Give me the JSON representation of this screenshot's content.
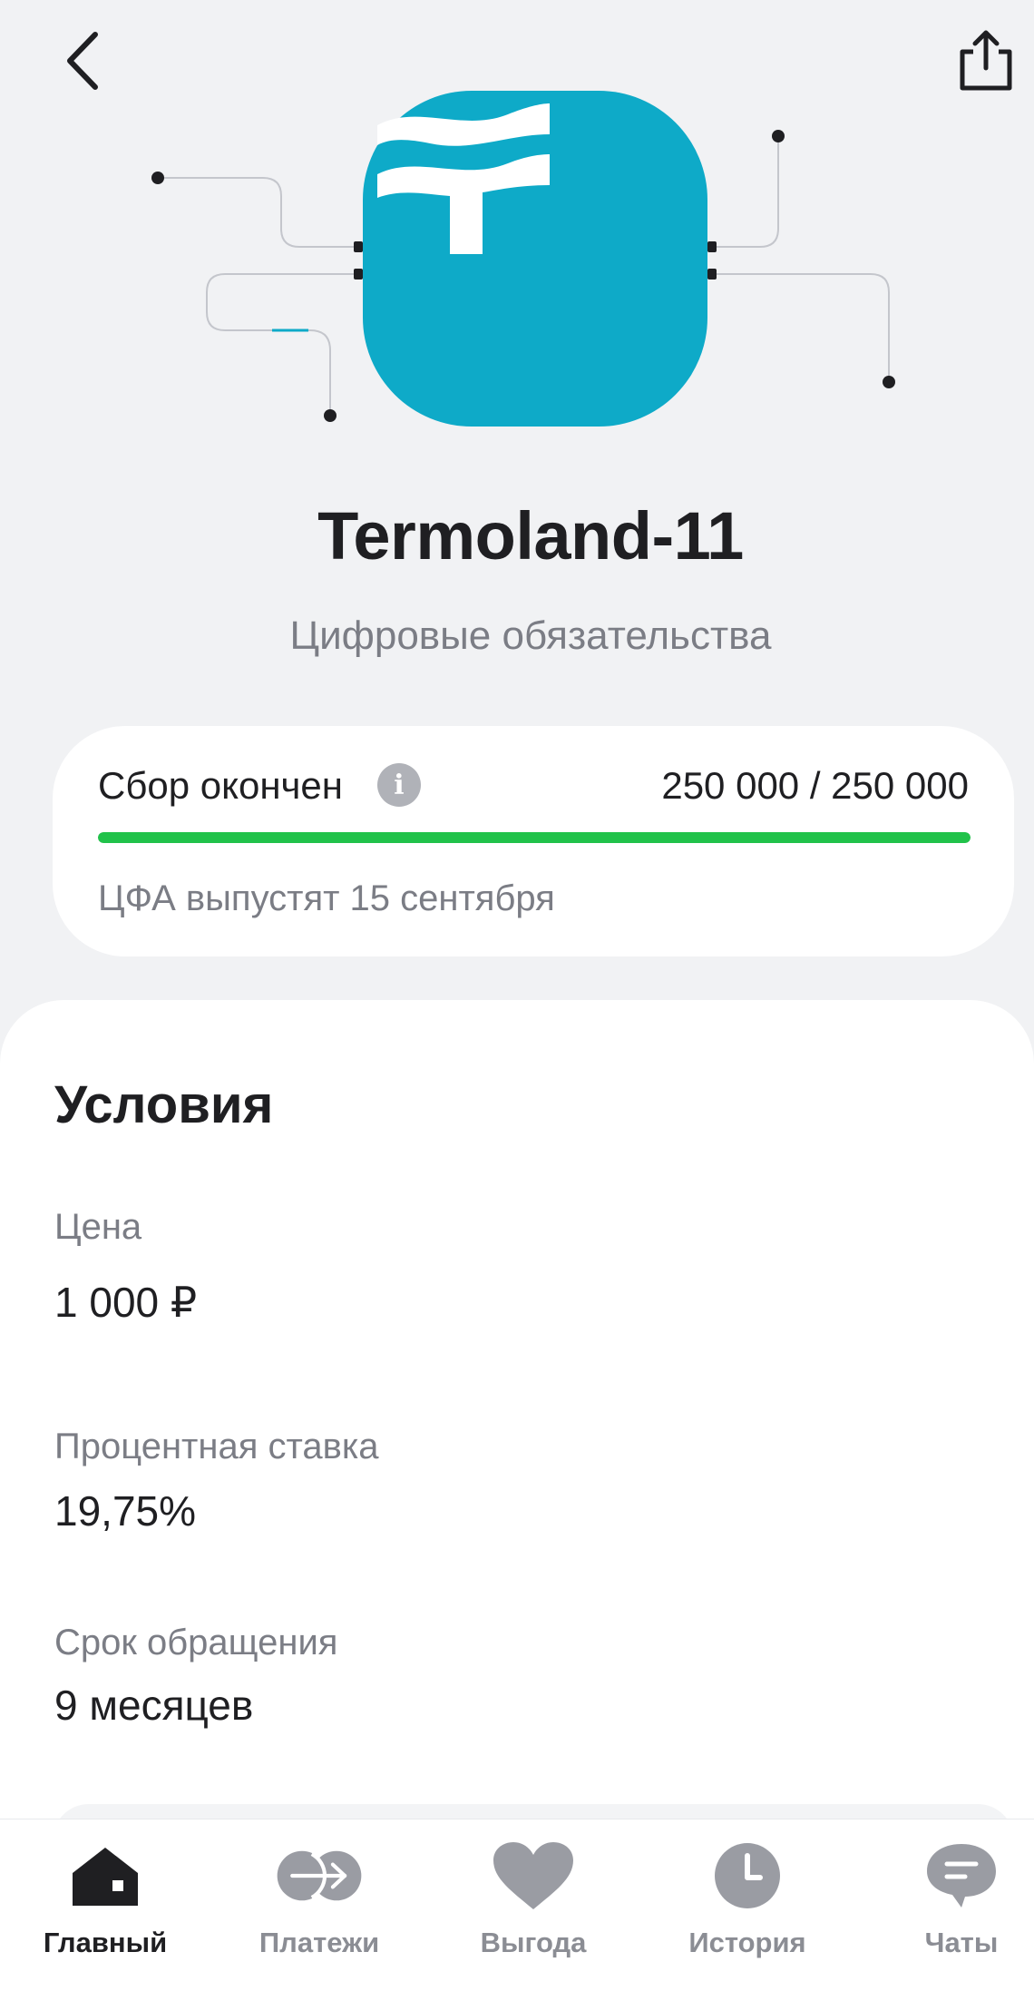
{
  "header": {
    "back_icon": "chevron-left-icon",
    "share_icon": "share-icon"
  },
  "product": {
    "name": "Termoland-11",
    "category": "Цифровые обязательства",
    "logo_icon": "termoland-logo-icon",
    "logo_color": "#0eaac8"
  },
  "fundraising": {
    "status": "Сбор окончен",
    "info_icon": "info-icon",
    "amount": "250 000 / 250 000",
    "progress_fraction": 1.0,
    "progress_color": "#21c24a",
    "note": "ЦФА выпустят 15 сентября"
  },
  "conditions": {
    "title": "Условия",
    "items": [
      {
        "label": "Цена",
        "value": "1 000 ₽"
      },
      {
        "label": "Процентная ставка",
        "value": "19,75%"
      },
      {
        "label": "Срок обращения",
        "value": "9 месяцев"
      }
    ]
  },
  "tabbar": {
    "tabs": [
      {
        "label": "Главный",
        "icon": "home-icon",
        "active": true
      },
      {
        "label": "Платежи",
        "icon": "transfer-arrow-icon",
        "active": false
      },
      {
        "label": "Выгода",
        "icon": "heart-icon",
        "active": false
      },
      {
        "label": "История",
        "icon": "clock-icon",
        "active": false
      },
      {
        "label": "Чаты",
        "icon": "chat-bubble-icon",
        "active": false
      }
    ]
  }
}
